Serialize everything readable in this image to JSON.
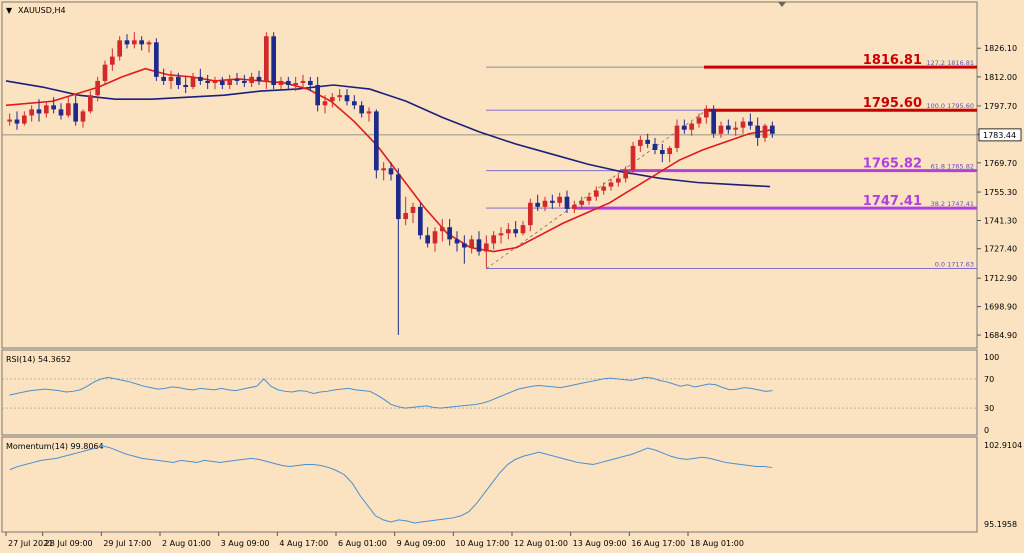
{
  "chart_data": [
    {
      "type": "candlestick",
      "title": "XAUUSD,H4",
      "title_marker": "▼",
      "price_range": [
        1680,
        1840
      ],
      "y_ticks": [
        "1826.10",
        "1812.00",
        "1797.70",
        "1783.60",
        "1769.70",
        "1755.30",
        "1741.30",
        "1727.40",
        "1712.90",
        "1698.90",
        "1684.90"
      ],
      "current_price": "1783.44",
      "candles": [
        [
          1790,
          1794,
          1788,
          1791
        ],
        [
          1791,
          1795,
          1786,
          1789
        ],
        [
          1789,
          1795,
          1788,
          1793
        ],
        [
          1793,
          1798,
          1790,
          1796
        ],
        [
          1796,
          1801,
          1790,
          1794
        ],
        [
          1794,
          1800,
          1792,
          1798
        ],
        [
          1798,
          1802,
          1794,
          1796
        ],
        [
          1796,
          1799,
          1791,
          1793
        ],
        [
          1793,
          1802,
          1792,
          1799
        ],
        [
          1799,
          1803,
          1788,
          1790
        ],
        [
          1790,
          1796,
          1787,
          1795
        ],
        [
          1795,
          1805,
          1794,
          1803
        ],
        [
          1803,
          1812,
          1800,
          1810
        ],
        [
          1810,
          1820,
          1808,
          1818
        ],
        [
          1818,
          1826,
          1815,
          1822
        ],
        [
          1822,
          1832,
          1820,
          1830
        ],
        [
          1830,
          1833,
          1826,
          1828
        ],
        [
          1828,
          1834,
          1826,
          1830
        ],
        [
          1830,
          1832,
          1825,
          1828
        ],
        [
          1828,
          1830,
          1824,
          1829
        ],
        [
          1829,
          1831,
          1810,
          1812
        ],
        [
          1812,
          1816,
          1808,
          1810
        ],
        [
          1810,
          1815,
          1806,
          1812
        ],
        [
          1812,
          1814,
          1806,
          1808
        ],
        [
          1808,
          1812,
          1804,
          1807
        ],
        [
          1807,
          1814,
          1806,
          1812
        ],
        [
          1812,
          1816,
          1808,
          1810
        ],
        [
          1810,
          1813,
          1806,
          1809
        ],
        [
          1809,
          1812,
          1806,
          1810
        ],
        [
          1810,
          1812,
          1806,
          1808
        ],
        [
          1808,
          1813,
          1806,
          1811
        ],
        [
          1811,
          1814,
          1808,
          1810
        ],
        [
          1810,
          1813,
          1807,
          1809
        ],
        [
          1809,
          1814,
          1807,
          1812
        ],
        [
          1812,
          1815,
          1808,
          1810
        ],
        [
          1810,
          1834,
          1806,
          1832
        ],
        [
          1832,
          1834,
          1806,
          1808
        ],
        [
          1808,
          1812,
          1806,
          1810
        ],
        [
          1810,
          1812,
          1806,
          1808
        ],
        [
          1808,
          1812,
          1805,
          1809
        ],
        [
          1809,
          1813,
          1806,
          1810
        ],
        [
          1810,
          1812,
          1805,
          1808
        ],
        [
          1808,
          1812,
          1795,
          1798
        ],
        [
          1798,
          1803,
          1794,
          1800
        ],
        [
          1800,
          1804,
          1797,
          1802
        ],
        [
          1802,
          1806,
          1800,
          1803
        ],
        [
          1803,
          1806,
          1798,
          1800
        ],
        [
          1800,
          1803,
          1796,
          1798
        ],
        [
          1798,
          1800,
          1792,
          1794
        ],
        [
          1794,
          1797,
          1790,
          1795
        ],
        [
          1795,
          1796,
          1762,
          1766
        ],
        [
          1766,
          1770,
          1761,
          1767
        ],
        [
          1767,
          1770,
          1761,
          1764
        ],
        [
          1764,
          1767,
          1685,
          1742
        ],
        [
          1742,
          1753,
          1739,
          1745
        ],
        [
          1745,
          1750,
          1740,
          1748
        ],
        [
          1748,
          1750,
          1732,
          1734
        ],
        [
          1734,
          1738,
          1728,
          1730
        ],
        [
          1730,
          1738,
          1726,
          1736
        ],
        [
          1736,
          1742,
          1731,
          1738
        ],
        [
          1738,
          1742,
          1729,
          1732
        ],
        [
          1732,
          1736,
          1726,
          1730
        ],
        [
          1730,
          1734,
          1720,
          1728
        ],
        [
          1728,
          1734,
          1725,
          1732
        ],
        [
          1732,
          1736,
          1724,
          1726
        ],
        [
          1726,
          1734,
          1718,
          1730
        ],
        [
          1730,
          1736,
          1727,
          1734
        ],
        [
          1734,
          1738,
          1730,
          1735
        ],
        [
          1735,
          1740,
          1732,
          1737
        ],
        [
          1737,
          1741,
          1733,
          1735
        ],
        [
          1735,
          1741,
          1734,
          1739
        ],
        [
          1739,
          1752,
          1736,
          1750
        ],
        [
          1750,
          1754,
          1746,
          1748
        ],
        [
          1748,
          1753,
          1746,
          1751
        ],
        [
          1751,
          1754,
          1747,
          1750
        ],
        [
          1750,
          1755,
          1748,
          1753
        ],
        [
          1753,
          1756,
          1745,
          1747
        ],
        [
          1747,
          1751,
          1745,
          1749
        ],
        [
          1749,
          1753,
          1747,
          1751
        ],
        [
          1751,
          1755,
          1749,
          1753
        ],
        [
          1753,
          1758,
          1751,
          1756
        ],
        [
          1756,
          1760,
          1754,
          1758
        ],
        [
          1758,
          1762,
          1756,
          1760
        ],
        [
          1760,
          1764,
          1758,
          1762
        ],
        [
          1762,
          1768,
          1760,
          1766
        ],
        [
          1766,
          1780,
          1764,
          1778
        ],
        [
          1778,
          1783,
          1775,
          1781
        ],
        [
          1781,
          1784,
          1777,
          1779
        ],
        [
          1779,
          1782,
          1774,
          1776
        ],
        [
          1776,
          1779,
          1770,
          1774
        ],
        [
          1774,
          1778,
          1770,
          1777
        ],
        [
          1777,
          1791,
          1775,
          1788
        ],
        [
          1788,
          1791,
          1784,
          1786
        ],
        [
          1786,
          1790,
          1783,
          1789
        ],
        [
          1789,
          1794,
          1787,
          1792
        ],
        [
          1792,
          1798,
          1789,
          1796
        ],
        [
          1796,
          1798,
          1782,
          1784
        ],
        [
          1784,
          1790,
          1782,
          1788
        ],
        [
          1788,
          1791,
          1784,
          1786
        ],
        [
          1786,
          1790,
          1783,
          1787
        ],
        [
          1787,
          1792,
          1784,
          1790
        ],
        [
          1790,
          1794,
          1786,
          1788
        ],
        [
          1788,
          1792,
          1778,
          1782
        ],
        [
          1782,
          1789,
          1780,
          1788
        ],
        [
          1788,
          1790,
          1782,
          1784
        ]
      ],
      "ma_red": [
        [
          0,
          1798
        ],
        [
          20,
          1800
        ],
        [
          40,
          1807
        ],
        [
          50,
          1812
        ],
        [
          60,
          1816
        ],
        [
          70,
          1813
        ],
        [
          80,
          1812
        ],
        [
          90,
          1810
        ],
        [
          100,
          1811
        ],
        [
          110,
          1810
        ],
        [
          120,
          1809
        ],
        [
          130,
          1806
        ],
        [
          140,
          1800
        ],
        [
          150,
          1790
        ],
        [
          160,
          1778
        ],
        [
          170,
          1763
        ],
        [
          180,
          1748
        ],
        [
          190,
          1735
        ],
        [
          200,
          1728
        ],
        [
          210,
          1726
        ],
        [
          220,
          1728
        ],
        [
          230,
          1734
        ],
        [
          240,
          1740
        ],
        [
          250,
          1745
        ],
        [
          260,
          1750
        ],
        [
          270,
          1757
        ],
        [
          280,
          1764
        ],
        [
          290,
          1771
        ],
        [
          300,
          1776
        ],
        [
          310,
          1780
        ],
        [
          320,
          1784
        ],
        [
          330,
          1786
        ]
      ],
      "ma_blue": [
        [
          0,
          1810
        ],
        [
          20,
          1807
        ],
        [
          40,
          1803
        ],
        [
          60,
          1801
        ],
        [
          80,
          1801
        ],
        [
          100,
          1802
        ],
        [
          120,
          1803
        ],
        [
          140,
          1805
        ],
        [
          160,
          1806
        ],
        [
          180,
          1808
        ],
        [
          200,
          1806
        ],
        [
          220,
          1800
        ],
        [
          240,
          1792
        ],
        [
          260,
          1785
        ],
        [
          280,
          1779
        ],
        [
          300,
          1774
        ],
        [
          320,
          1769
        ],
        [
          340,
          1765
        ],
        [
          360,
          1762
        ],
        [
          380,
          1760
        ],
        [
          400,
          1759
        ],
        [
          420,
          1758
        ]
      ],
      "fib_levels": [
        {
          "ratio": "127.2",
          "price": "1816.81",
          "label": "1816.81",
          "color": "#c80000"
        },
        {
          "ratio": "100.0",
          "price": "1795.60",
          "label": "1795.60",
          "color": "#c80000"
        },
        {
          "ratio": "61.8",
          "price": "1765.82",
          "label": "1765.82",
          "color": "#b040e0"
        },
        {
          "ratio": "38.2",
          "price": "1747.41",
          "label": "1747.41",
          "color": "#b040e0"
        },
        {
          "ratio": "0.0",
          "price": "1717.63",
          "label": "",
          "color": "#b040e0"
        }
      ]
    },
    {
      "type": "line",
      "title": "RSI(14) 54.3652",
      "ylim": [
        0,
        100
      ],
      "y_ticks": [
        "100",
        "70",
        "30",
        "0"
      ],
      "levels": [
        70,
        30
      ],
      "values": [
        48,
        50,
        52,
        54,
        55,
        56,
        55,
        54,
        52,
        53,
        55,
        60,
        66,
        70,
        72,
        70,
        68,
        66,
        63,
        60,
        58,
        56,
        57,
        59,
        58,
        56,
        55,
        57,
        56,
        55,
        57,
        55,
        54,
        56,
        58,
        60,
        70,
        60,
        55,
        53,
        52,
        54,
        53,
        50,
        52,
        53,
        55,
        56,
        57,
        55,
        54,
        53,
        48,
        42,
        35,
        32,
        30,
        31,
        32,
        33,
        31,
        30,
        31,
        32,
        33,
        34,
        35,
        37,
        40,
        44,
        48,
        52,
        56,
        58,
        60,
        61,
        60,
        59,
        58,
        60,
        62,
        64,
        66,
        68,
        70,
        71,
        70,
        69,
        68,
        70,
        72,
        71,
        68,
        66,
        63,
        60,
        62,
        59,
        61,
        63,
        62,
        58,
        55,
        56,
        58,
        57,
        55,
        53,
        54
      ]
    },
    {
      "type": "line",
      "title": "Momentum(14) 99.8064",
      "ylim": [
        95.1,
        102.9
      ],
      "y_ticks": [
        "102.9104",
        "95.1958"
      ],
      "values": [
        100.5,
        100.8,
        101.0,
        101.2,
        101.4,
        101.5,
        101.6,
        101.8,
        102.0,
        102.2,
        102.4,
        102.6,
        102.8,
        102.6,
        102.3,
        102.0,
        101.8,
        101.6,
        101.5,
        101.4,
        101.3,
        101.2,
        101.4,
        101.3,
        101.2,
        101.4,
        101.3,
        101.2,
        101.3,
        101.4,
        101.5,
        101.6,
        101.5,
        101.3,
        101.1,
        100.9,
        100.8,
        100.9,
        101.0,
        101.0,
        100.9,
        100.7,
        100.4,
        100.0,
        99.2,
        98.0,
        97.0,
        96.0,
        95.6,
        95.4,
        95.6,
        95.5,
        95.3,
        95.4,
        95.5,
        95.6,
        95.7,
        95.8,
        96.0,
        96.4,
        97.2,
        98.2,
        99.2,
        100.2,
        101.0,
        101.5,
        101.8,
        102.0,
        102.2,
        102.0,
        101.8,
        101.6,
        101.4,
        101.2,
        101.1,
        101.0,
        101.2,
        101.4,
        101.6,
        101.8,
        102.0,
        102.3,
        102.6,
        102.4,
        102.1,
        101.8,
        101.6,
        101.5,
        101.6,
        101.7,
        101.6,
        101.4,
        101.2,
        101.1,
        101.0,
        100.9,
        100.8,
        100.8,
        100.7
      ]
    }
  ],
  "x_ticks": [
    {
      "label": "27 Jul 2021",
      "at": 0
    },
    {
      "label": "28 Jul 09:00",
      "at": 5
    },
    {
      "label": "29 Jul 17:00",
      "at": 13
    },
    {
      "label": "2 Aug 01:00",
      "at": 21
    },
    {
      "label": "3 Aug 09:00",
      "at": 29
    },
    {
      "label": "4 Aug 17:00",
      "at": 37
    },
    {
      "label": "6 Aug 01:00",
      "at": 45
    },
    {
      "label": "9 Aug 09:00",
      "at": 53
    },
    {
      "label": "10 Aug 17:00",
      "at": 61
    },
    {
      "label": "12 Aug 01:00",
      "at": 69
    },
    {
      "label": "13 Aug 09:00",
      "at": 77
    },
    {
      "label": "16 Aug 17:00",
      "at": 85
    },
    {
      "label": "18 Aug 01:00",
      "at": 93
    }
  ],
  "colors": {
    "background": "#fbe3c1",
    "bull": "#d22a2a",
    "bear": "#1e2a8c",
    "ma_red": "#e01a1a",
    "ma_blue": "#1a1f7c",
    "grid_line": "#888888"
  }
}
